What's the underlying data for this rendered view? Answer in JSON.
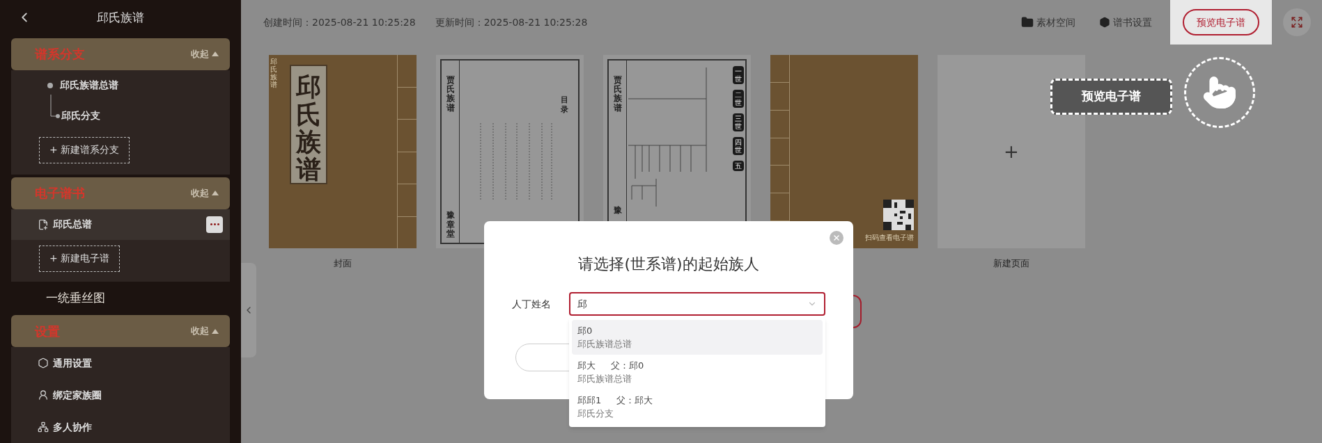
{
  "sidebar": {
    "title": "邱氏族谱",
    "sections": [
      {
        "kind": "branches",
        "title": "谱系分支",
        "toggle": "收起",
        "expanded": true,
        "tree": [
          {
            "name": "邱氏族谱总谱",
            "children": [
              {
                "name": "邱氏分支"
              }
            ]
          }
        ],
        "add_button": "+ 新建谱系分支"
      },
      {
        "kind": "books",
        "title": "电子谱书",
        "toggle": "收起",
        "expanded": true,
        "items": [
          {
            "name": "邱氏总谱",
            "selected": true
          }
        ],
        "add_button": "+ 新建电子谱"
      },
      {
        "kind": "link",
        "title": "一统垂丝图"
      },
      {
        "kind": "settings",
        "title": "设置",
        "toggle": "收起",
        "expanded": true,
        "items": [
          {
            "name": "通用设置"
          },
          {
            "name": "绑定家族圈"
          },
          {
            "name": "多人协作"
          }
        ]
      }
    ]
  },
  "header": {
    "created": "创建时间：2025-08-21 10:25:28",
    "updated": "更新时间：2025-08-21 10:25:28",
    "actions": [
      "素材空间",
      "谱书设置"
    ],
    "preview_button": "预览电子谱"
  },
  "pages": [
    {
      "kind": "cover",
      "title": "邱氏族谱",
      "subtitle": "邱氏族谱",
      "label": "封面"
    },
    {
      "kind": "toc",
      "title": "贾氏族谱",
      "heading": "目录",
      "hall": "豫章堂"
    },
    {
      "kind": "tree",
      "title": "贾氏族谱",
      "generations": [
        "一世",
        "二世",
        "三世",
        "四世",
        "五"
      ],
      "hall": "豫"
    },
    {
      "kind": "back",
      "qr_caption": "扫码查看电子谱"
    },
    {
      "kind": "new",
      "symbol": "+",
      "label": "新建页面"
    }
  ],
  "tour": {
    "tip": "预览电子谱"
  },
  "dialog": {
    "title": "请选择(世系谱)的起始族人",
    "field_label": "人丁姓名",
    "value": "邱",
    "options": [
      {
        "name": "邱0",
        "branch": "邱氏族谱总谱",
        "selected": true
      },
      {
        "name": "邱大",
        "father": "父：邱0",
        "branch": "邱氏族谱总谱",
        "selected": false
      },
      {
        "name": "邱邱1",
        "father": "父：邱大",
        "branch": "邱氏分支",
        "selected": false
      }
    ]
  }
}
